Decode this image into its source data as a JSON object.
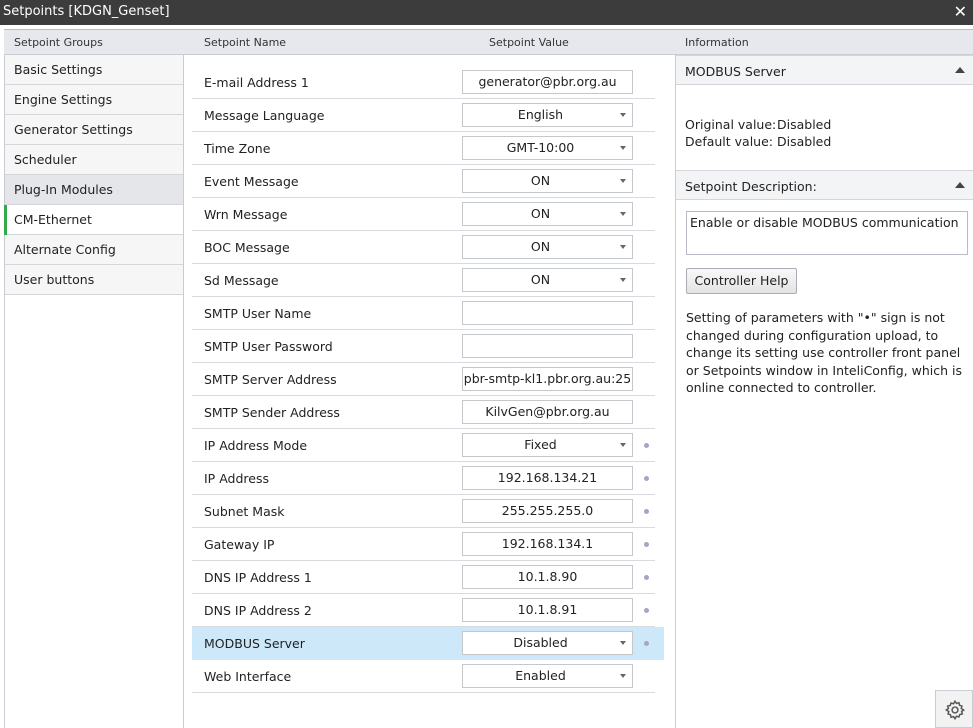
{
  "window": {
    "title": "Setpoints [KDGN_Genset]",
    "close_glyph": "✕"
  },
  "header": {
    "groups": "Setpoint Groups",
    "name": "Setpoint Name",
    "value": "Setpoint Value",
    "info": "Information"
  },
  "groups": [
    {
      "label": "Basic Settings"
    },
    {
      "label": "Engine Settings"
    },
    {
      "label": "Generator Settings"
    },
    {
      "label": "Scheduler"
    },
    {
      "label": "Plug-In Modules"
    },
    {
      "label": "CM-Ethernet"
    },
    {
      "label": "Alternate Config"
    },
    {
      "label": "User buttons"
    }
  ],
  "active_group": "CM-Ethernet",
  "setpoints": [
    {
      "name": "E-mail Address 1",
      "value": "generator@pbr.org.au"
    },
    {
      "name": "Message Language",
      "value": "English"
    },
    {
      "name": "Time Zone",
      "value": "GMT-10:00"
    },
    {
      "name": "Event Message",
      "value": "ON"
    },
    {
      "name": "Wrn Message",
      "value": "ON"
    },
    {
      "name": "BOC Message",
      "value": "ON"
    },
    {
      "name": "Sd Message",
      "value": "ON"
    },
    {
      "name": "SMTP User Name",
      "value": ""
    },
    {
      "name": "SMTP User Password",
      "value": ""
    },
    {
      "name": "SMTP Server Address",
      "value": "pbr-smtp-kl1.pbr.org.au:25"
    },
    {
      "name": "SMTP Sender Address",
      "value": "KilvGen@pbr.org.au"
    },
    {
      "name": "IP Address Mode",
      "value": "Fixed"
    },
    {
      "name": "IP Address",
      "value": "192.168.134.21"
    },
    {
      "name": "Subnet Mask",
      "value": "255.255.255.0"
    },
    {
      "name": "Gateway IP",
      "value": "192.168.134.1"
    },
    {
      "name": "DNS IP Address 1",
      "value": "10.1.8.90"
    },
    {
      "name": "DNS IP Address 2",
      "value": "10.1.8.91"
    },
    {
      "name": "MODBUS Server",
      "value": "Disabled"
    },
    {
      "name": "Web Interface",
      "value": "Enabled"
    }
  ],
  "selected_setpoint": "MODBUS Server",
  "info": {
    "section_title": "MODBUS Server",
    "original_label": "Original value:",
    "original_value": "Disabled",
    "default_label": "Default value:",
    "default_value": "Disabled",
    "description_header": "Setpoint Description:",
    "description": "Enable or disable MODBUS communication",
    "help_button": "Controller Help",
    "note": "Setting of parameters with \"•\" sign is not changed during configuration upload, to change its setting use controller front panel or Setpoints window in InteliConfig, which is online connected to controller."
  },
  "colors": {
    "selection": "#cce8f9",
    "active_indicator": "#35a84a",
    "titlebar": "#3c3c3c",
    "protected_dot": "#a8a3c8"
  },
  "icons": {
    "settings": "gear-icon",
    "collapse": "triangle-up-icon",
    "dropdown": "chevron-down-icon",
    "protected": "dot-icon"
  }
}
